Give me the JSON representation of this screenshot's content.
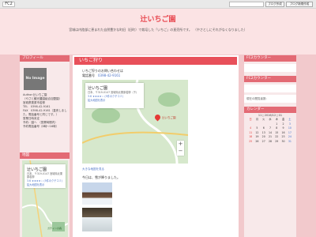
{
  "topbar": {
    "logo": "FC2",
    "create_label": "ブログ作成",
    "login_label": "ブログ新規作成"
  },
  "header": {
    "title": "辻いちご園",
    "description": "宮城は内陸部に恵まれた自然豊かな町旧（旧町）で栽培した「いちご」の直売所です。　（やさとしにそれがなくなりました）"
  },
  "left": {
    "profile_title": "プロフィール",
    "noimage": "No Image",
    "profile_lines": [
      "Author:辻いちご園",
      "（やさと観光農園組合加盟園）",
      "宮城県栗原市若柳",
      "TEL　0398-42-9161",
      "FAX　0398-42-9161（直売しました。電話番号と同じです。）",
      "",
      "営業日時未定",
      "予約：園へ　（営業時間内）",
      "予約電話番号（8時〜16時）"
    ],
    "map_title": "地図",
    "card": {
      "name": "辻いちご園",
      "addr": "日本、〒319-0147 宮城県北栗原若柳",
      "rating": "3.6 ★★★★☆ (5件のクチコミ)",
      "link": "拡大地図を表示"
    },
    "sign_label": "ガチャンの森"
  },
  "main": {
    "post_title": "いちご狩り",
    "intro_line1": "いちご狩りのお問い合わせは",
    "intro_phone_label": "電話番号",
    "intro_phone": "0398-42-9161",
    "map_card": {
      "name": "辻いちご園",
      "addr": "日本、〒319-0147 宮城県北栗原若柳（下）",
      "rating": "3.6 ★★★★☆ (5件のクチコミ)",
      "link": "拡大地図を表示"
    },
    "pin_label": "辻いちご園",
    "map_link": "大きな地図を見る",
    "today_text": "今日は、雪が降りました。"
  },
  "right": {
    "counter_title": "FC2カウンター",
    "counter2_title": "FC2カウンター",
    "visitors_title": "現在の閲覧者数:",
    "calendar_title": "カレンダー",
    "month": "11 | 2016/12 | 01",
    "weekdays": [
      "日",
      "月",
      "火",
      "水",
      "木",
      "金",
      "土"
    ],
    "days": [
      "",
      "",
      "",
      "",
      "1",
      "2",
      "3",
      "4",
      "5",
      "6",
      "7",
      "8",
      "9",
      "10",
      "11",
      "12",
      "13",
      "14",
      "15",
      "16",
      "17",
      "18",
      "19",
      "20",
      "21",
      "22",
      "23",
      "24",
      "25",
      "26",
      "27",
      "28",
      "29",
      "30",
      "31"
    ]
  }
}
